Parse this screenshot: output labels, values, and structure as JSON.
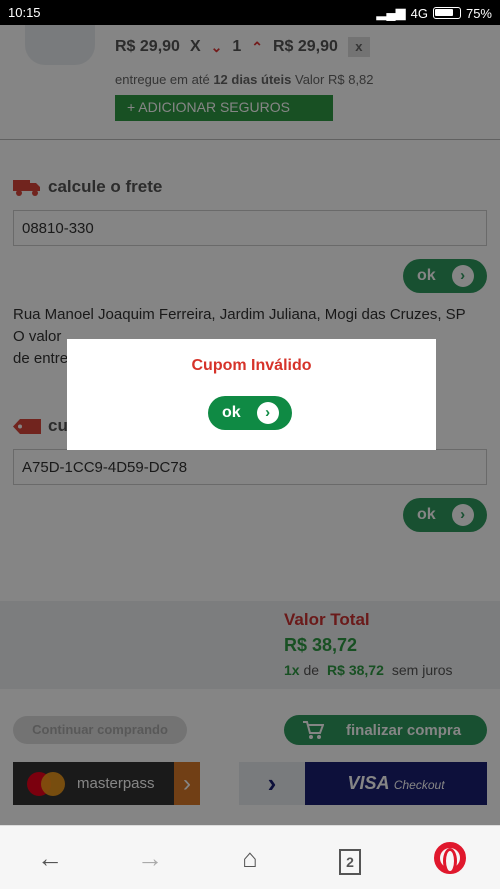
{
  "status_bar": {
    "time": "10:15",
    "network": "4G",
    "battery": "75%"
  },
  "cart_item": {
    "unit_price": "R$ 29,90",
    "times": "X",
    "quantity": "1",
    "line_total": "R$ 29,90",
    "remove_label": "x",
    "delivery_prefix": "entregue em até",
    "delivery_days": "12 dias úteis",
    "delivery_value": "Valor R$ 8,82",
    "insurance_button": "+ ADICIONAR SEGUROS"
  },
  "shipping": {
    "title": "calcule o frete",
    "cep_value": "08810-330",
    "ok_label": "ok",
    "address": "Rua Manoel Joaquim Ferreira, Jardim Juliana, Mogi das Cruzes, SP",
    "value_line_partial": "O valor",
    "delivery_line_partial": "de entre"
  },
  "coupon": {
    "title_partial": "cu",
    "code_value": "A75D-1CC9-4D59-DC78",
    "ok_label": "ok"
  },
  "summary": {
    "total_label": "Valor Total",
    "total_amount": "R$ 38,72",
    "installments_count": "1x",
    "installments_of": "de",
    "installment_value": "R$ 38,72",
    "interest": "sem juros"
  },
  "actions": {
    "continue_label": "Continuar comprando",
    "checkout_label": "finalizar compra"
  },
  "payments": {
    "masterpass_label": "masterpass",
    "visa_label": "VISA",
    "visa_sub": "Checkout"
  },
  "modal": {
    "title": "Cupom Inválido",
    "ok_label": "ok"
  },
  "navbar": {
    "tabs_count": "2"
  },
  "colors": {
    "primary_green": "#2e9a5f",
    "error_red": "#d6332a",
    "opera_red": "#e0182d"
  }
}
